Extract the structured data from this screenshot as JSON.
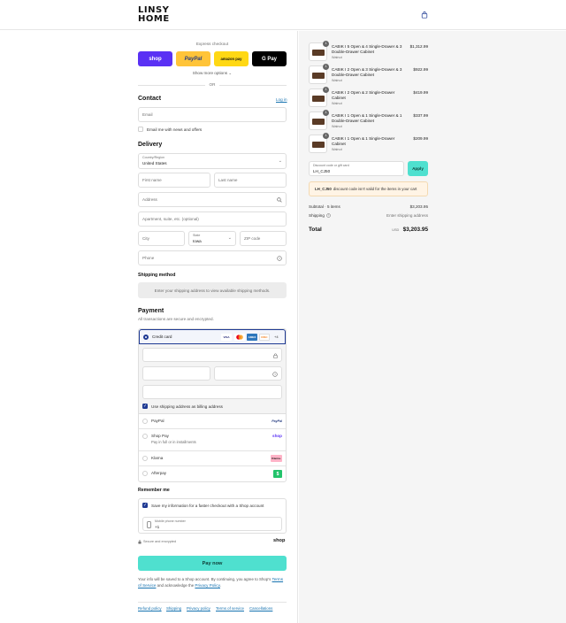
{
  "header": {
    "logo_line1": "LINSY",
    "logo_line2": "HOME",
    "cart_icon": "shopping-bag-icon"
  },
  "express": {
    "label": "Express checkout",
    "buttons": {
      "shop": "shop",
      "paypal": "PayPal",
      "amazon": "amazon pay",
      "gpay": "G Pay"
    },
    "show_more": "Show more options ⌄",
    "or": "OR"
  },
  "contact": {
    "title": "Contact",
    "login": "Log in",
    "email_placeholder": "Email",
    "news_label": "Email me with news and offers"
  },
  "delivery": {
    "title": "Delivery",
    "country_label": "Country/Region",
    "country_value": "United States",
    "first_name": "First name",
    "last_name": "Last name",
    "address": "Address",
    "apartment": "Apartment, suite, etc. (optional)",
    "city": "City",
    "state_label": "State",
    "state_value": "Iowa",
    "zip": "ZIP code",
    "phone": "Phone"
  },
  "shipping_method": {
    "title": "Shipping method",
    "message": "Enter your shipping address to view available shipping methods."
  },
  "payment": {
    "title": "Payment",
    "subtitle": "All transactions are secure and encrypted.",
    "credit_card": "Credit card",
    "card_logos": [
      "VISA",
      "MC",
      "AMEX",
      "DISC"
    ],
    "more_cards": "+4",
    "billing_same": "Use shipping address as billing address",
    "methods": [
      {
        "name": "PayPal",
        "logo": "PayPal"
      },
      {
        "name": "Shop Pay",
        "sub": "Pay in full or in installments",
        "logo": "shop"
      },
      {
        "name": "Klarna",
        "logo": "Klarna."
      },
      {
        "name": "Afterpay",
        "logo": "$"
      }
    ]
  },
  "remember": {
    "title": "Remember me",
    "save_label": "Save my information for a faster checkout with a Shop account",
    "mobile_label": "Mobile phone number",
    "mobile_value": "+1",
    "secure": "Secure and encrypted",
    "shop_logo": "shop"
  },
  "pay_now": "Pay now",
  "legal": {
    "text1": "Your info will be saved to a Shop account. By continuing, you agree to Shop's",
    "tos": "Terms of Service",
    "text2": "and acknowledge the",
    "privacy": "Privacy Policy",
    "end": "."
  },
  "footer_links": [
    "Refund policy",
    "Shipping",
    "Privacy policy",
    "Terms of service",
    "Cancellations"
  ],
  "cart": {
    "items": [
      {
        "qty": "1",
        "name": "CABIK I 5 Open & 4 Single-Drawer & 3 Double-Drawer Cabinet",
        "variant": "Walnut",
        "price": "$1,312.99"
      },
      {
        "qty": "1",
        "name": "CABIK I 2 Open & 3 Single-Drawer & 3 Double-Drawer Cabinet",
        "variant": "Walnut",
        "price": "$922.99"
      },
      {
        "qty": "1",
        "name": "CABIK I 2 Open & 2 Single-Drawer Cabinet",
        "variant": "Walnut",
        "price": "$419.99"
      },
      {
        "qty": "1",
        "name": "CABIK I 1 Open & 1 Single-Drawer & 1 Double-Drawer Cabinet",
        "variant": "Walnut",
        "price": "$337.99"
      },
      {
        "qty": "1",
        "name": "CABIK I 1 Open & 1 Single-Drawer Cabinet",
        "variant": "Walnut",
        "price": "$209.99"
      }
    ],
    "discount_label": "Discount code or gift card",
    "discount_value": "LH_CJ50",
    "apply": "Apply",
    "warning_code": "LH_CJ50",
    "warning_text": "discount code isn't valid for the items in your cart",
    "subtotal_label": "Subtotal · 5 items",
    "subtotal_value": "$3,203.95",
    "shipping_label": "Shipping",
    "shipping_value": "Enter shipping address",
    "total_label": "Total",
    "currency": "USD",
    "total_value": "$3,203.95"
  }
}
